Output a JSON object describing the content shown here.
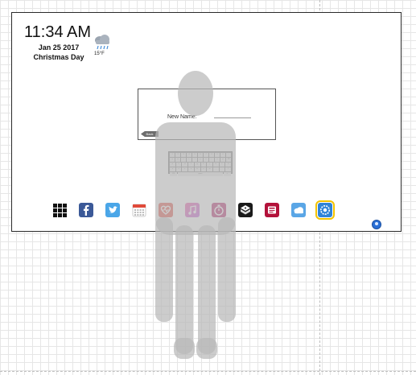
{
  "clock": {
    "time": "11:34 AM",
    "date": "Jan 25 2017",
    "holiday": "Christmas Day"
  },
  "weather": {
    "icon": "rain-cloud-icon",
    "temperature": "15°F"
  },
  "dialog": {
    "field_label": "New Name:",
    "back_label": "Back"
  },
  "keyboard": {
    "rows": [
      [
        "1",
        "2",
        "3",
        "4",
        "5",
        "6",
        "7",
        "8",
        "9",
        "0",
        "-"
      ],
      [
        "q",
        "w",
        "e",
        "r",
        "t",
        "y",
        "u",
        "i",
        "o",
        "p",
        "⌫"
      ],
      [
        "a",
        "s",
        "d",
        "f",
        "g",
        "h",
        "j",
        "k",
        "l",
        "↵"
      ],
      [
        "z",
        "x",
        "c",
        "v",
        "b",
        "n",
        "m",
        ",",
        ".",
        "⇧"
      ],
      [
        "123",
        "space",
        "☺"
      ]
    ]
  },
  "dock": {
    "apps": [
      {
        "name": "app-grid-icon",
        "color": "#111111"
      },
      {
        "name": "facebook-icon",
        "color": "#3b5998"
      },
      {
        "name": "twitter-icon",
        "color": "#4aa6e8"
      },
      {
        "name": "calendar-icon",
        "color": "#e04a3a"
      },
      {
        "name": "health-icon",
        "color": "#e0463c"
      },
      {
        "name": "music-icon",
        "color": "#b84fd9"
      },
      {
        "name": "timer-icon",
        "color": "#b0125f"
      },
      {
        "name": "dice-icon",
        "color": "#1a1a1a"
      },
      {
        "name": "news-icon",
        "color": "#b3123a"
      },
      {
        "name": "weather-app-icon",
        "color": "#5aa6e6"
      },
      {
        "name": "settings-icon",
        "color": "#2f84d8"
      }
    ],
    "selected_index": 10
  }
}
